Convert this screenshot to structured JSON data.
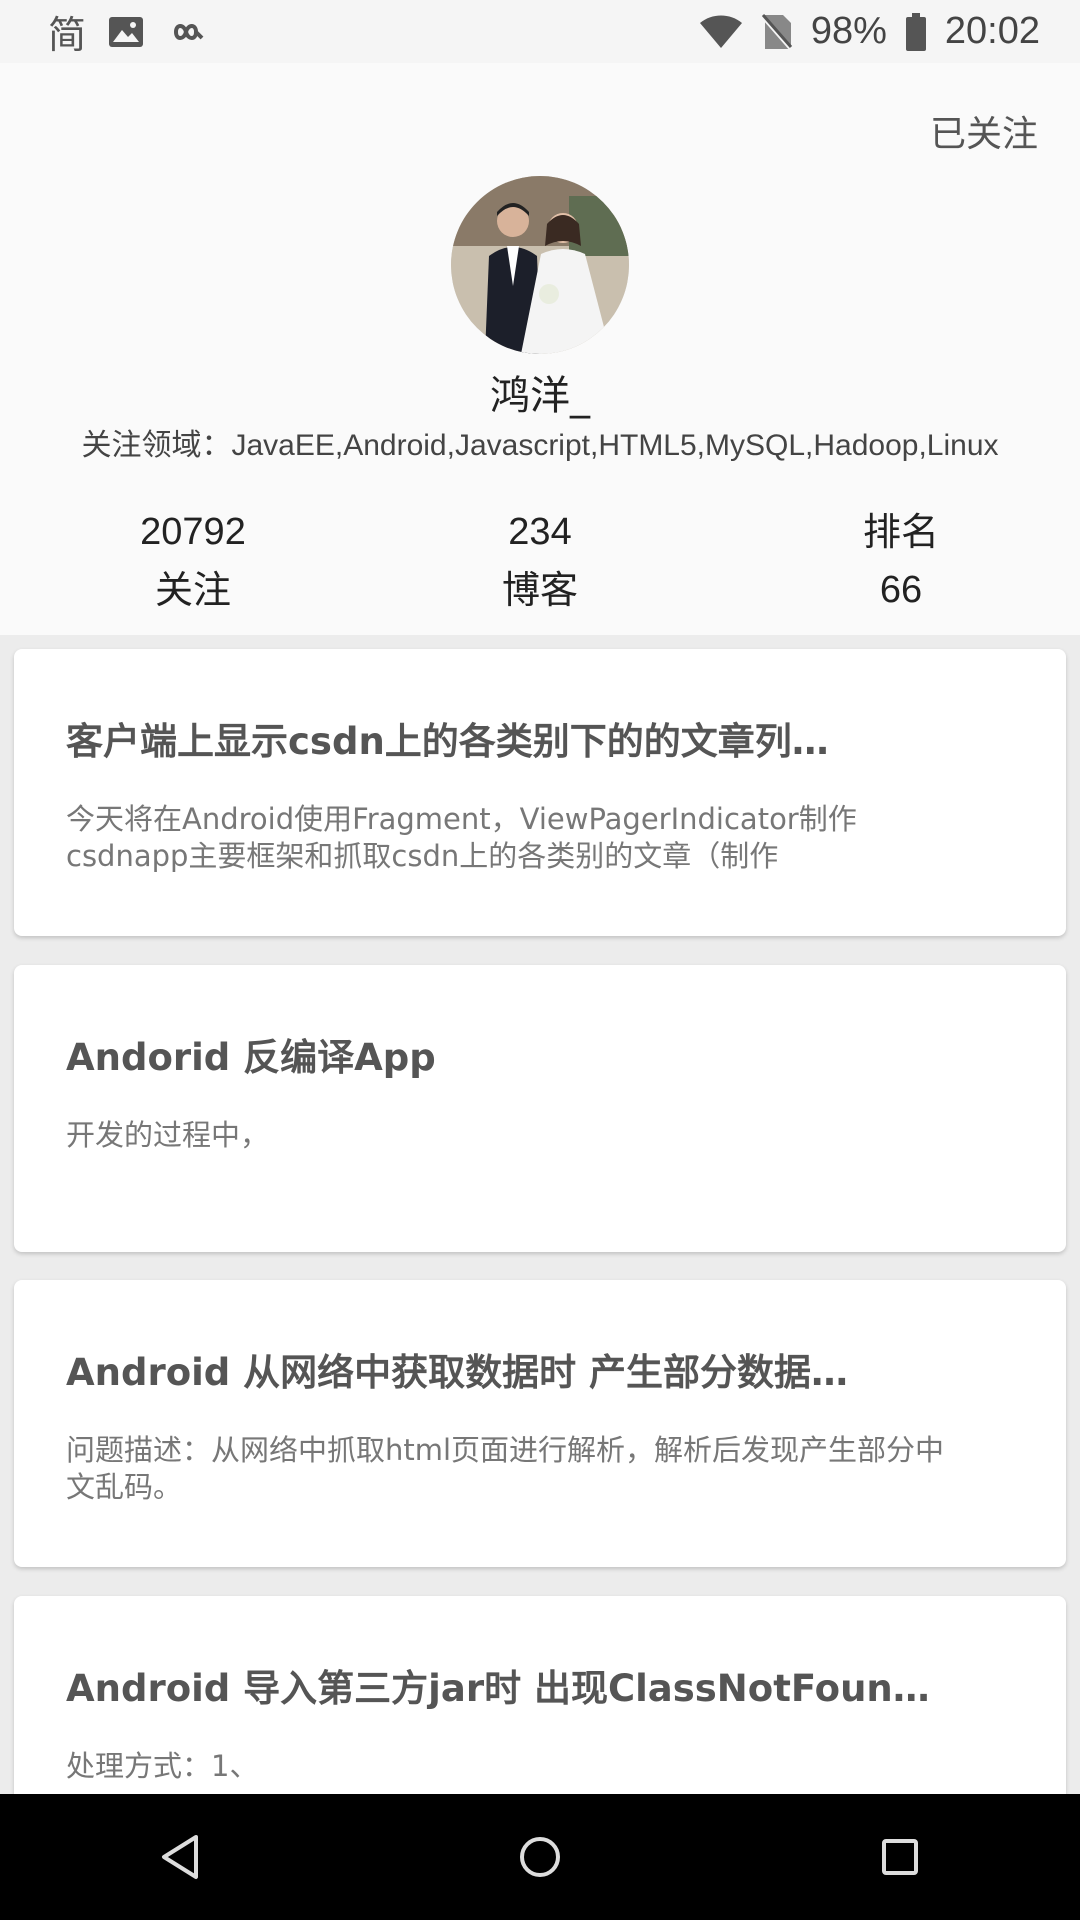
{
  "status_bar": {
    "left_icons": [
      "simplified-chinese-icon",
      "image-icon",
      "infinity-icon"
    ],
    "simplified_label": "简",
    "battery_percent": "98%",
    "time": "20:02"
  },
  "profile": {
    "follow_status": "已关注",
    "username": "鸿洋_",
    "domains": "关注领域：JavaEE,Android,Javascript,HTML5,MySQL,Hadoop,Linux",
    "stats": [
      {
        "top": "20792",
        "bottom": "关注"
      },
      {
        "top": "234",
        "bottom": "博客"
      },
      {
        "top": "排名",
        "bottom": "66"
      }
    ]
  },
  "articles": [
    {
      "title": "客户端上显示csdn上的各类别下的的文章列…",
      "summary": "今天将在Android使用Fragment，ViewPagerIndicator制作csdnapp主要框架和抓取csdn上的各类别的文章（制作"
    },
    {
      "title": "Andorid 反编译App",
      "summary": "开发的过程中，"
    },
    {
      "title": "Android 从网络中获取数据时 产生部分数据…",
      "summary": "问题描述：从网络中抓取html页面进行解析，解析后发现产生部分中文乱码。"
    },
    {
      "title": "Android 导入第三方jar时 出现ClassNotFoun…",
      "summary": "处理方式：1、"
    }
  ],
  "nav_bar": {
    "buttons": [
      "back-icon",
      "home-icon",
      "recents-icon"
    ]
  }
}
